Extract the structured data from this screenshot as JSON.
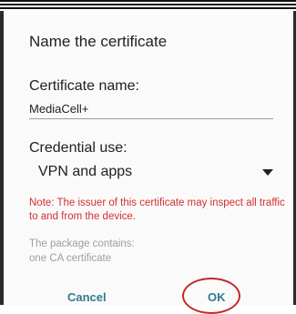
{
  "dialog": {
    "title": "Name the certificate",
    "certificate_name_label": "Certificate name:",
    "certificate_name_value": "MediaCell+",
    "credential_use_label": "Credential use:",
    "credential_use_value": "VPN and apps",
    "note": "Note: The issuer of this certificate may inspect all traffic to and from the device.",
    "package_label": "The package contains:",
    "package_value": "one CA certificate",
    "cancel_label": "Cancel",
    "ok_label": "OK"
  },
  "colors": {
    "note_text": "#d32f2f",
    "button_text": "#2e7d8c",
    "highlight_circle": "#c62828",
    "muted_text": "#9e9e9e"
  },
  "icons": {
    "dropdown": "caret-down-icon"
  }
}
